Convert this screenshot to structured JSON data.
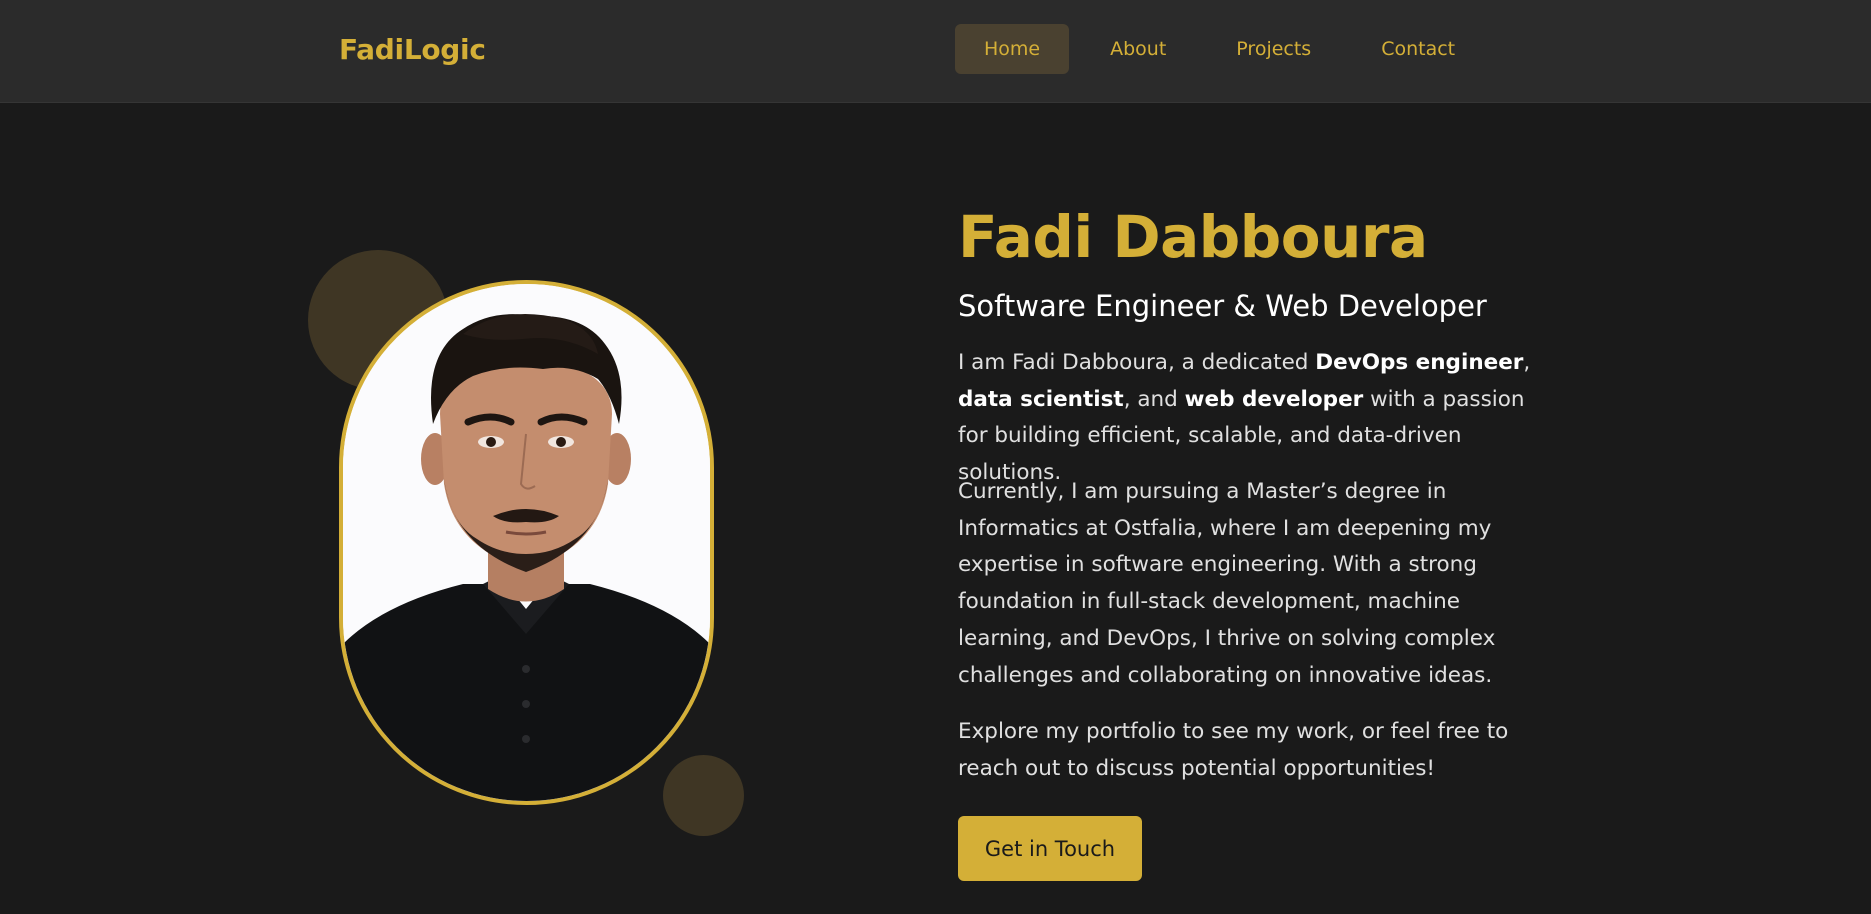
{
  "nav": {
    "logo": "FadiLogic",
    "links": [
      {
        "label": "Home",
        "active": true
      },
      {
        "label": "About",
        "active": false
      },
      {
        "label": "Projects",
        "active": false
      },
      {
        "label": "Contact",
        "active": false
      }
    ]
  },
  "hero": {
    "name": "Fadi Dabboura",
    "role": "Software Engineer & Web Developer",
    "bio_1": {
      "t1": "I am Fadi Dabboura, a dedicated ",
      "b1": "DevOps engineer",
      "t2": ", ",
      "b2": "data scientist",
      "t3": ", and ",
      "b3": "web developer",
      "t4": " with a passion for building efficient, scalable, and data-driven solutions."
    },
    "bio_2": "Currently, I am pursuing a Master’s degree in Informatics at Ostfalia, where I am deepening my expertise in software engineering. With a strong foundation in full-stack development, machine learning, and DevOps, I thrive on solving complex challenges and collaborating on innovative ideas.",
    "bio_3": "Explore my portfolio to see my work, or feel free to reach out to discuss potential opportunities!",
    "cta_label": "Get in Touch"
  },
  "colors": {
    "accent": "#d4af37",
    "background": "#1a1a1a",
    "navbar": "#2b2b2b"
  }
}
